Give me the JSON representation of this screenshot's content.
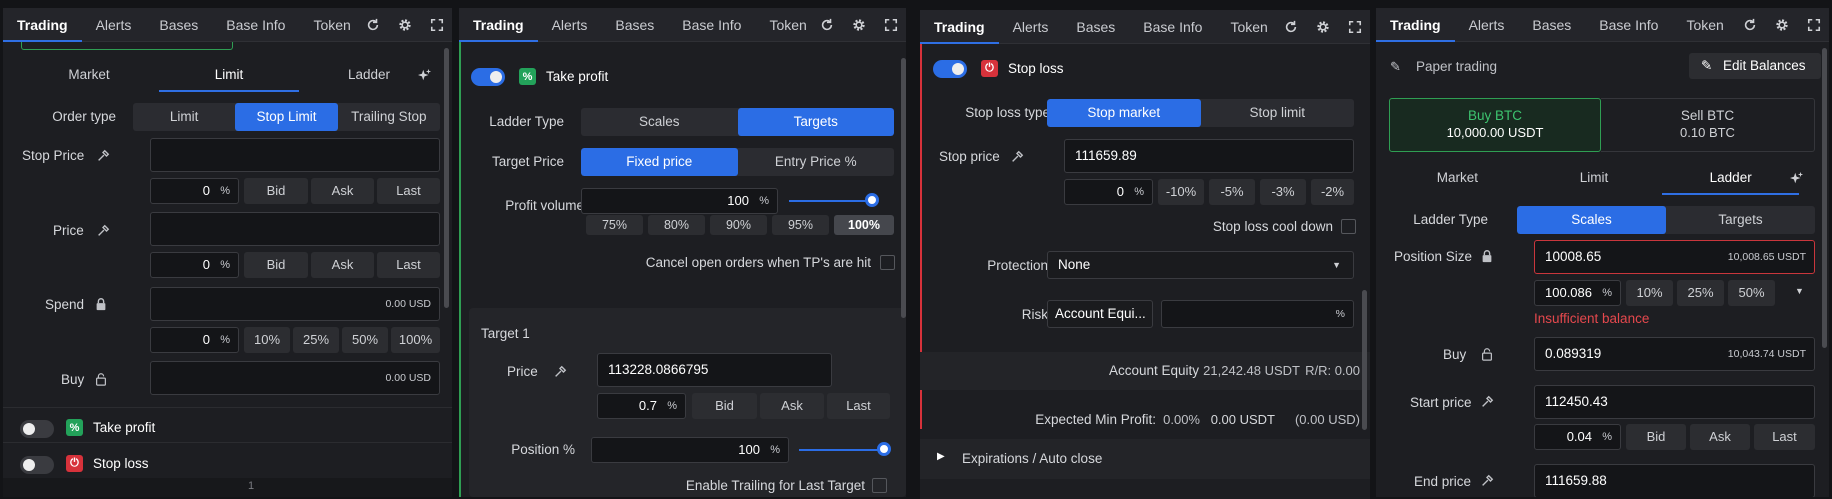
{
  "tabs": [
    "Trading",
    "Alerts",
    "Bases",
    "Base Info",
    "Token"
  ],
  "p1": {
    "order_tabs": [
      "Market",
      "Limit",
      "Ladder"
    ],
    "order_type_label": "Order type",
    "order_types": [
      "Limit",
      "Stop Limit",
      "Trailing Stop"
    ],
    "stop_price_label": "Stop Price",
    "price_label": "Price",
    "spend_label": "Spend",
    "buy_label": "Buy",
    "zero": "0",
    "pct": "%",
    "quick": [
      "Bid",
      "Ask",
      "Last"
    ],
    "pcts": [
      "10%",
      "25%",
      "50%",
      "100%"
    ],
    "spend_value": "0.00 USD",
    "buy_value": "0.00 USD",
    "take_profit": "Take profit",
    "stop_loss": "Stop loss",
    "footer_num": "1"
  },
  "p2": {
    "take_profit": "Take profit",
    "ladder_type_label": "Ladder Type",
    "ladder_types": [
      "Scales",
      "Targets"
    ],
    "target_price_label": "Target Price",
    "target_price_opts": [
      "Fixed price",
      "Entry Price %"
    ],
    "profit_volume_label": "Profit volume",
    "profit_volume": "100",
    "pct": "%",
    "vol_opts": [
      "75%",
      "80%",
      "90%",
      "95%",
      "100%"
    ],
    "cancel_label": "Cancel open orders when TP's are hit",
    "target_title": "Target 1",
    "price_label": "Price",
    "price_value": "113228.0866795",
    "price_pct": "0.7",
    "quick": [
      "Bid",
      "Ask",
      "Last"
    ],
    "position_label": "Position %",
    "position_value": "100",
    "trailing_label": "Enable Trailing for Last Target"
  },
  "p3": {
    "stop_loss": "Stop loss",
    "sl_type_label": "Stop loss type",
    "sl_types": [
      "Stop market",
      "Stop limit"
    ],
    "stop_price_label": "Stop price",
    "stop_price_value": "111659.89",
    "zero": "0",
    "pct": "%",
    "neg_pcts": [
      "-10%",
      "-5%",
      "-3%",
      "-2%"
    ],
    "cooldown_label": "Stop loss cool down",
    "protection_label": "Protection",
    "protection_value": "None",
    "risk_label": "Risk",
    "risk_value": "Account Equi...",
    "equity_label": "Account Equity",
    "equity_value": "21,242.48 USDT",
    "rr": "R/R: 0.00",
    "min_profit_label": "Expected Min Profit:",
    "min_profit_pct": "0.00%",
    "min_profit_usdt": "0.00 USDT",
    "min_profit_paren": "(0.00 USD)",
    "expirations_label": "Expirations / Auto close"
  },
  "p4": {
    "paper_trading": "Paper trading",
    "edit_balances": "Edit Balances",
    "buy_btc": "Buy BTC",
    "buy_btc_val": "10,000.00 USDT",
    "sell_btc": "Sell BTC",
    "sell_btc_val": "0.10 BTC",
    "order_tabs": [
      "Market",
      "Limit",
      "Ladder"
    ],
    "ladder_type_label": "Ladder Type",
    "ladder_types": [
      "Scales",
      "Targets"
    ],
    "position_size_label": "Position Size",
    "position_size_value": "10008.65",
    "position_size_suffix": "10,008.65 USDT",
    "pos_pct": "100.086",
    "pct": "%",
    "pcts": [
      "10%",
      "25%",
      "50%"
    ],
    "insufficient": "Insufficient balance",
    "buy_label": "Buy",
    "buy_value": "0.089319",
    "buy_suffix": "10,043.74 USDT",
    "start_price_label": "Start price",
    "start_price_value": "112450.43",
    "start_pct": "0.04",
    "quick": [
      "Bid",
      "Ask",
      "Last"
    ],
    "end_price_label": "End price",
    "end_price_value": "111659.88"
  }
}
